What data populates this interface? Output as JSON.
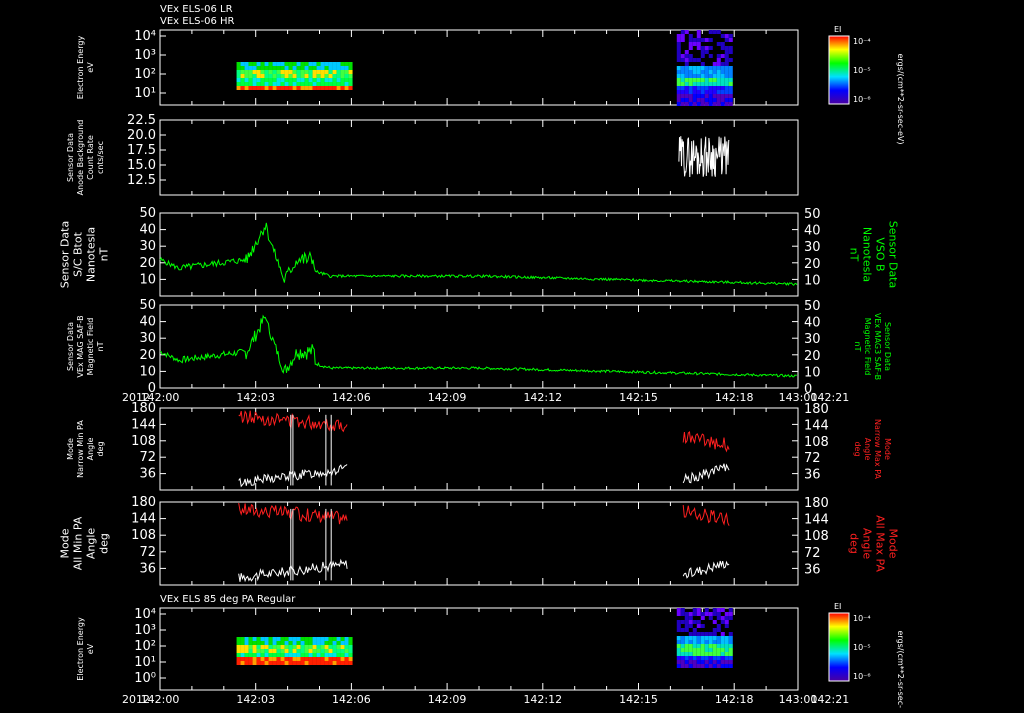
{
  "titles": {
    "line1": "VEx ELS-06 LR",
    "line2": "VEx ELS-06 HR",
    "bottom_panel": "VEx ELS 85 deg PA Regular"
  },
  "x_axis": {
    "ticks": [
      "142:00",
      "142:03",
      "142:06",
      "142:09",
      "142:12",
      "142:15",
      "142:18",
      "142:21",
      "143:00"
    ],
    "year": "2012"
  },
  "colorbar": {
    "label": "EI",
    "top_tick": "10⁻⁴",
    "mid_tick": "10⁻⁵",
    "bottom_tick": "10⁻⁶",
    "units": "ergs/(cm**2-sr-sec-eV)"
  },
  "colors": {
    "white": "#ffffff",
    "green": "#00ff00",
    "red": "#ff2020"
  },
  "panels": [
    {
      "id": "spec-lr",
      "ylabel_lines": [
        "Electron Energy",
        "eV"
      ],
      "y_ticks": [
        "10⁴",
        "10³",
        "10²",
        "10¹"
      ],
      "right_labels": []
    },
    {
      "id": "background",
      "ylabel_lines": [
        "Sensor Data",
        "Anode Background",
        "Count Rate",
        "cnts/sec"
      ],
      "y_ticks": [
        "22.5",
        "20.0",
        "17.5",
        "15.0",
        "12.5"
      ],
      "ylim": [
        10,
        22.5
      ],
      "right_labels": []
    },
    {
      "id": "bmag-sc",
      "ylabel_lines": [
        "Sensor Data",
        "S/C Btot",
        "Nanotesla",
        "nT"
      ],
      "y_ticks": [
        "50",
        "40",
        "30",
        "20",
        "10"
      ],
      "ylim": [
        0,
        50
      ],
      "right_ticks": [
        "50",
        "40",
        "30",
        "20",
        "10"
      ],
      "right_labels": [
        "Sensor Data",
        "VSO B",
        "Nanotesla",
        "nT"
      ]
    },
    {
      "id": "bmag-saf",
      "ylabel_lines": [
        "Sensor Data",
        "VEx MAG SAF-B",
        "Magnetic Field",
        "nT"
      ],
      "y_ticks": [
        "50",
        "40",
        "30",
        "20",
        "10",
        "0"
      ],
      "ylim": [
        0,
        50
      ],
      "right_ticks": [
        "50",
        "40",
        "30",
        "20",
        "10",
        "0"
      ],
      "right_labels": [
        "Sensor Data",
        "VEx MAG3 SAF-B",
        "Magnetic Field",
        "nT"
      ]
    },
    {
      "id": "pa-narrow",
      "ylabel_lines": [
        "Mode",
        "Narrow Min PA",
        "Angle",
        "deg"
      ],
      "y_ticks": [
        "180",
        "144",
        "108",
        "72",
        "36"
      ],
      "ylim": [
        0,
        180
      ],
      "right_ticks": [
        "180",
        "144",
        "108",
        "72",
        "36"
      ],
      "right_labels": [
        "Mode",
        "Narrow Max PA",
        "Angle",
        "deg"
      ]
    },
    {
      "id": "pa-all",
      "ylabel_lines": [
        "Mode",
        "All Min PA",
        "Angle",
        "deg"
      ],
      "y_ticks": [
        "180",
        "144",
        "108",
        "72",
        "36"
      ],
      "ylim": [
        0,
        180
      ],
      "right_ticks": [
        "180",
        "144",
        "108",
        "72",
        "36"
      ],
      "right_labels": [
        "Mode",
        "All Max PA",
        "Angle",
        "deg"
      ]
    },
    {
      "id": "spec-85",
      "ylabel_lines": [
        "Electron Energy",
        "eV"
      ],
      "y_ticks": [
        "10⁴",
        "10³",
        "10²",
        "10¹",
        "10⁰"
      ],
      "right_labels": []
    }
  ],
  "chart_data": {
    "type": "line",
    "x_range": [
      "142:00",
      "143:00"
    ],
    "series": [
      {
        "name": "S/C Btot",
        "x": [
          "142:00",
          "142:01",
          "142:02",
          "142:03",
          "142:04",
          "142:04.5",
          "142:05",
          "142:05.3",
          "142:06",
          "142:07",
          "142:09",
          "142:12",
          "142:15",
          "142:18",
          "142:21",
          "143:00"
        ],
        "values": [
          22,
          18,
          17,
          16,
          20,
          44,
          20,
          8,
          24,
          15,
          12,
          11,
          9,
          8,
          8,
          7
        ]
      },
      {
        "name": "VEx MAG SAF-B",
        "x": [
          "142:00",
          "142:01",
          "142:02",
          "142:03",
          "142:04",
          "142:04.5",
          "142:05",
          "142:05.3",
          "142:06",
          "142:07",
          "142:09",
          "142:12",
          "142:15",
          "142:18",
          "142:21",
          "143:00"
        ],
        "values": [
          22,
          18,
          20,
          17,
          22,
          44,
          22,
          8,
          26,
          14,
          12,
          12,
          9,
          8,
          8,
          7
        ]
      },
      {
        "name": "Narrow Min PA",
        "x": [
          "142:03",
          "142:04",
          "142:05",
          "142:06",
          "142:06.8",
          "142:20",
          "142:21",
          "142:21.2"
        ],
        "values": [
          10,
          15,
          40,
          45,
          30,
          20,
          25,
          80
        ]
      },
      {
        "name": "Narrow Max PA",
        "x": [
          "142:03",
          "142:04",
          "142:05",
          "142:06",
          "142:06.8",
          "142:20",
          "142:21",
          "142:21.2"
        ],
        "values": [
          165,
          160,
          125,
          120,
          140,
          110,
          120,
          110
        ]
      },
      {
        "name": "Anode Background",
        "x": [
          "142:20",
          "142:20.5",
          "142:21",
          "142:21.2"
        ],
        "values": [
          17,
          16,
          19,
          17
        ]
      }
    ]
  }
}
